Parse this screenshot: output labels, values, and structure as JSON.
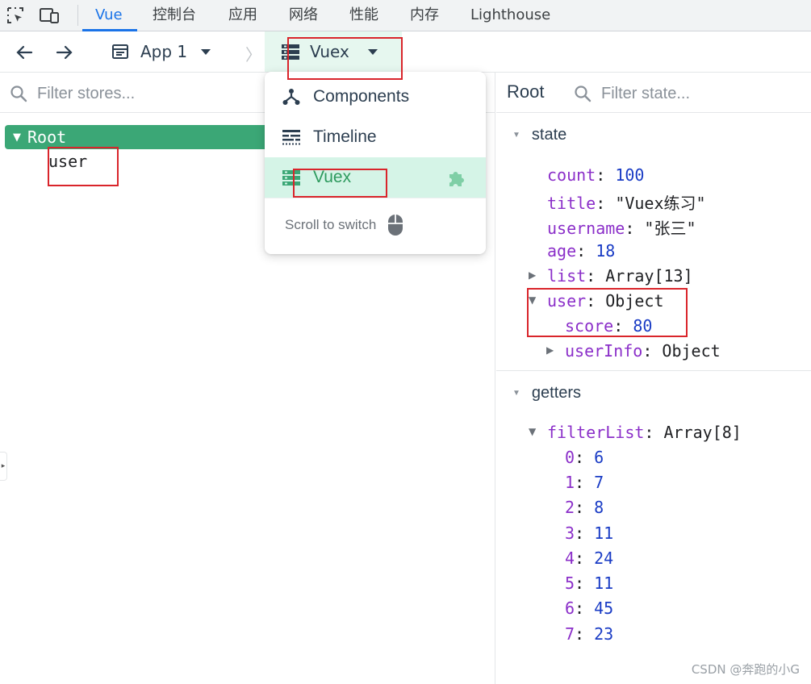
{
  "devtools_tabs": [
    {
      "label": "Vue",
      "active": true
    },
    {
      "label": "控制台",
      "active": false
    },
    {
      "label": "应用",
      "active": false
    },
    {
      "label": "网络",
      "active": false
    },
    {
      "label": "性能",
      "active": false
    },
    {
      "label": "内存",
      "active": false
    },
    {
      "label": "Lighthouse",
      "active": false
    }
  ],
  "toolbar": {
    "app_label": "App 1",
    "current_view": "Vuex"
  },
  "dropdown": {
    "items": [
      {
        "label": "Components",
        "icon": "components-icon",
        "selected": false
      },
      {
        "label": "Timeline",
        "icon": "timeline-icon",
        "selected": false
      },
      {
        "label": "Vuex",
        "icon": "vuex-icon",
        "selected": true
      }
    ],
    "hint": "Scroll to switch"
  },
  "stores": {
    "filter_placeholder": "Filter stores...",
    "root_label": "Root",
    "children": [
      "user"
    ]
  },
  "inspector": {
    "title": "Root",
    "filter_placeholder": "Filter state...",
    "state_label": "state",
    "state": {
      "count": {
        "key": "count",
        "value": "100"
      },
      "title": {
        "key": "title",
        "value": "\"Vuex练习\""
      },
      "username": {
        "key": "username",
        "value": "\"张三\""
      },
      "age": {
        "key": "age",
        "value": "18"
      },
      "list": {
        "key": "list",
        "value": "Array[13]"
      },
      "user": {
        "key": "user",
        "value": "Object"
      },
      "score": {
        "key": "score",
        "value": "80"
      },
      "userInfo": {
        "key": "userInfo",
        "value": "Object"
      }
    },
    "getters_label": "getters",
    "filterList": {
      "key": "filterList",
      "value": "Array[8]"
    },
    "filterList_items": [
      {
        "index": "0",
        "value": "6"
      },
      {
        "index": "1",
        "value": "7"
      },
      {
        "index": "2",
        "value": "8"
      },
      {
        "index": "3",
        "value": "11"
      },
      {
        "index": "4",
        "value": "24"
      },
      {
        "index": "5",
        "value": "11"
      },
      {
        "index": "6",
        "value": "45"
      },
      {
        "index": "7",
        "value": "23"
      }
    ]
  },
  "watermark": "CSDN @奔跑的小G",
  "colors": {
    "accent": "#1a73e8",
    "vue_green": "#3ba776",
    "annotation_red": "#d9252b",
    "key_purple": "#8b2fc9",
    "number_blue": "#1a3cc5"
  }
}
